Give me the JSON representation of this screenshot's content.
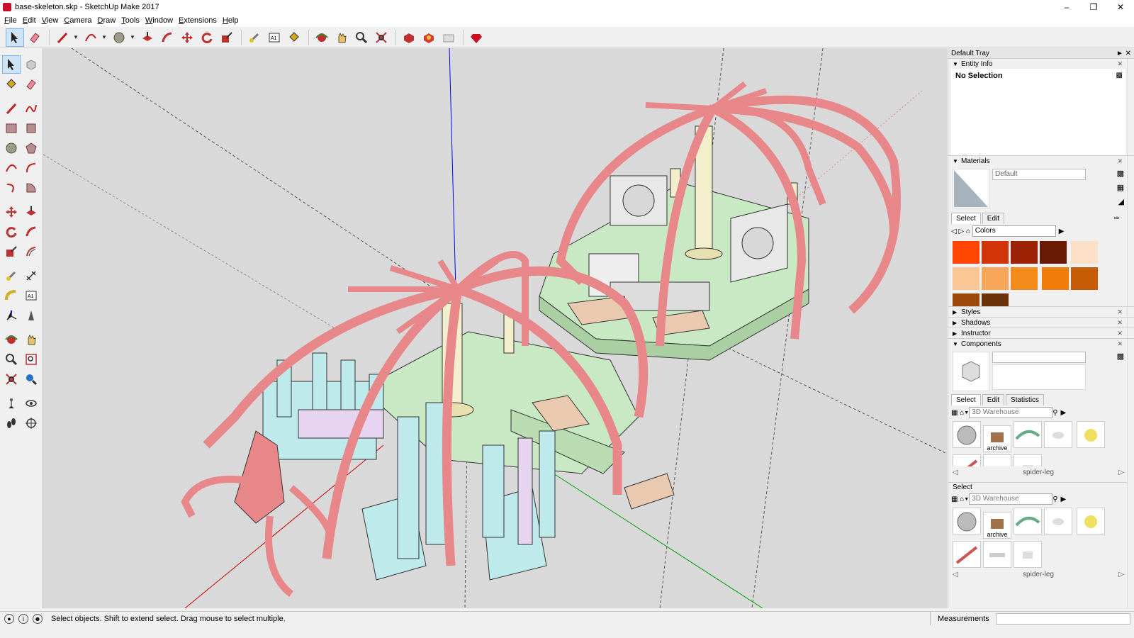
{
  "window": {
    "title": "base-skeleton.skp - SketchUp Make 2017",
    "controls": [
      "minimize-icon",
      "restore-icon",
      "close-icon"
    ]
  },
  "menu": [
    "File",
    "Edit",
    "View",
    "Camera",
    "Draw",
    "Tools",
    "Window",
    "Extensions",
    "Help"
  ],
  "toolbar": {
    "icons": [
      "select-icon",
      "eraser-icon",
      "line-icon",
      "arc-icon",
      "circle-icon",
      "push-pull-icon",
      "follow-me-icon",
      "move-icon",
      "rotate-icon",
      "scale-icon",
      "tape-measure-icon",
      "text-icon",
      "paint-bucket-icon",
      "orbit-icon",
      "pan-icon",
      "zoom-icon",
      "zoom-extents-icon",
      "3d-warehouse-icon",
      "extension-warehouse-icon",
      "layout-icon",
      "ruby-icon"
    ]
  },
  "tray": {
    "title": "Default Tray",
    "entity_info": {
      "label": "Entity Info",
      "selection": "No Selection"
    },
    "materials": {
      "label": "Materials",
      "name_value": "Default",
      "tabs": [
        "Select",
        "Edit"
      ],
      "library": "Colors",
      "swatches": [
        "#ff4500",
        "#d2340a",
        "#9c2206",
        "#6a1a04",
        "#fde0c8",
        "#fbc796",
        "#f7a65a",
        "#f28b1a",
        "#f07d0a",
        "#c65c06",
        "#9b4a0b",
        "#6a3208"
      ]
    },
    "collapsed_panels": [
      "Styles",
      "Shadows",
      "Instructor"
    ],
    "components": {
      "label": "Components",
      "tabs": [
        "Select",
        "Edit",
        "Statistics"
      ],
      "search_value": "3D Warehouse",
      "thumbs": [
        "",
        "archive",
        "",
        ""
      ],
      "collection": "spider-leg"
    },
    "secondary_select": {
      "label": "Select",
      "search_value": "3D Warehouse",
      "thumbs": [
        "",
        "archive",
        "",
        ""
      ],
      "collection": "spider-leg"
    }
  },
  "status": {
    "message": "Select objects. Shift to extend select. Drag mouse to select multiple.",
    "measurements_label": "Measurements"
  },
  "colors": {
    "viewport_bg": "#d9d9d9",
    "leg_red": "#e8878a",
    "base_green": "#c9e8c4",
    "leg_cyan": "#bfeaec",
    "axis_blue": "#0000ff",
    "axis_red": "#cc0000",
    "axis_green": "#00a000"
  }
}
